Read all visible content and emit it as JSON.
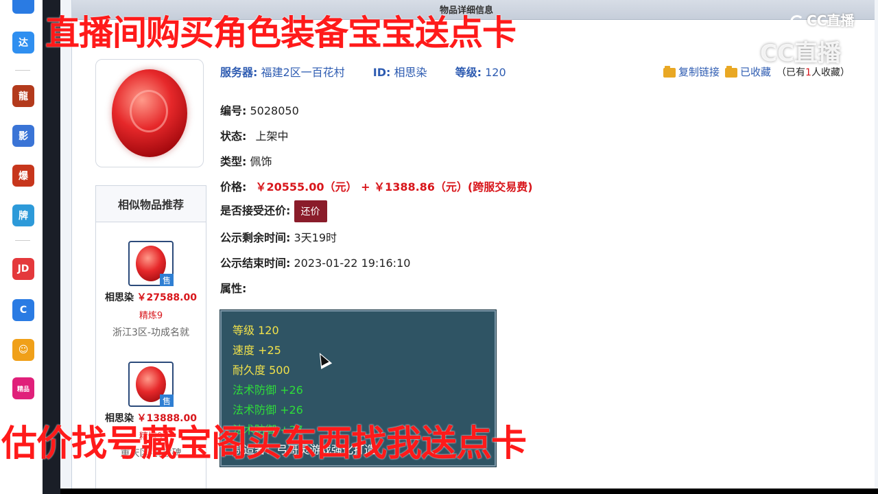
{
  "dock": {
    "items": [
      {
        "icon": "browser-icon",
        "color": "#2a7be3",
        "label": ""
      },
      {
        "icon": "da-app-icon",
        "color": "#2f8ff0",
        "label": "达"
      },
      {
        "icon": "game-dragon-icon",
        "color": "#b33a1c",
        "label": "龍"
      },
      {
        "icon": "game-blue-icon",
        "color": "#3a74d6",
        "label": "影"
      },
      {
        "icon": "game-bao-icon",
        "color": "#c7361c",
        "label": "爆"
      },
      {
        "icon": "game-mahjong-icon",
        "color": "#2d9ad9",
        "label": "牌"
      },
      {
        "icon": "jd-icon",
        "color": "#e4393c",
        "label": "JD"
      },
      {
        "icon": "refresh-app-icon",
        "color": "#2a7be3",
        "label": "C"
      },
      {
        "icon": "fox-app-icon",
        "color": "#f0a019",
        "label": "☺"
      },
      {
        "icon": "shop-app-icon",
        "color": "#e0207a",
        "label": "精品"
      }
    ]
  },
  "window": {
    "title": "物品详细信息"
  },
  "item": {
    "server_label": "服务器:",
    "server_value": "福建2区一百花村",
    "id_label": "ID:",
    "id_value": "相思染",
    "level_label": "等级:",
    "level_value": "120",
    "copy_link": "复制链接",
    "collected": "已收藏",
    "collect_note_prefix": "（已有",
    "collect_count": "1",
    "collect_note_suffix": "人收藏）",
    "number_label": "编号:",
    "number_value": "5028050",
    "status_label": "状态:",
    "status_value": "上架中",
    "type_label": "类型:",
    "type_value": "佩饰",
    "price_label": "价格:",
    "price_value": "￥20555.00（元）  +  ￥1388.86（元）(跨服交易费)",
    "bargain_label": "是否接受还价:",
    "bargain_button": "还价",
    "remaining_label": "公示剩余时间:",
    "remaining_value": "3天19时",
    "end_label": "公示结束时间:",
    "end_value": "2023-01-22 19:16:10",
    "attr_label": "属性:"
  },
  "attributes": [
    {
      "text": "等级 120",
      "color": "yellow"
    },
    {
      "text": "速度 +25",
      "color": "yellow"
    },
    {
      "text": "耐久度 500",
      "color": "yellow"
    },
    {
      "text": "法术防御 +26",
      "color": "green"
    },
    {
      "text": "法术防御 +26",
      "color": "green"
    },
    {
      "text": "法术防御 +27",
      "color": "green"
    },
    {
      "text": "制造者：弓哥灵游戏强化打造",
      "color": "white"
    }
  ],
  "similar": {
    "title": "相似物品推荐",
    "items": [
      {
        "name": "相思染",
        "price": "￥27588.00",
        "refine": "精炼9",
        "server": "浙江3区-功成名就",
        "badge": "售"
      },
      {
        "name": "相思染",
        "price": "￥13888.00",
        "refine": "精炼9",
        "server": "重庆区-解放碑",
        "badge": "售"
      }
    ]
  },
  "overlay": {
    "top": "直播间购买角色装备宝宝送点卡",
    "bottom": "估价找号藏宝阁买东西找我送点卡",
    "watermark_small": "CC直播",
    "watermark_big": "CC直播"
  }
}
